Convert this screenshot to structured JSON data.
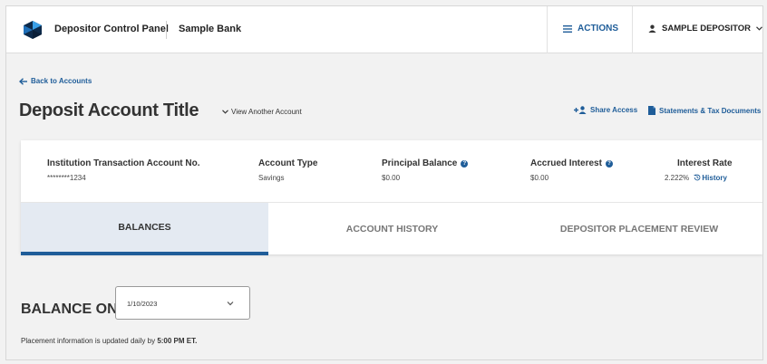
{
  "header": {
    "app_title": "Depositor Control Panel",
    "bank_name": "Sample Bank",
    "actions_label": "ACTIONS",
    "user_label": "SAMPLE DEPOSITOR",
    "brand_color": "#1f5d99"
  },
  "nav": {
    "back_label": "Back to Accounts"
  },
  "page": {
    "title": "Deposit Account Title",
    "view_another_label": "View Another Account",
    "share_access_label": "Share Access",
    "statements_label": "Statements & Tax Documents"
  },
  "summary": {
    "account_no_label": "Institution Transaction Account No.",
    "account_no_value": "********1234",
    "account_type_label": "Account Type",
    "account_type_value": "Savings",
    "principal_label": "Principal Balance",
    "principal_value": "$0.00",
    "accrued_label": "Accrued Interest",
    "accrued_value": "$0.00",
    "rate_label": "Interest Rate",
    "rate_value": "2.222%",
    "history_label": "History"
  },
  "tabs": [
    {
      "label": "BALANCES",
      "active": true
    },
    {
      "label": "ACCOUNT HISTORY",
      "active": false
    },
    {
      "label": "DEPOSITOR PLACEMENT REVIEW",
      "active": false
    }
  ],
  "balance": {
    "label": "BALANCE ON",
    "date_value": "1/10/2023",
    "note_prefix": "Placement information is updated daily by ",
    "note_time": "5:00 PM ET."
  },
  "icons": {
    "logo": "bank-logo-icon",
    "actions": "menu-icon",
    "user": "person-icon",
    "back": "arrow-left-icon",
    "share": "add-person-icon",
    "statements": "document-icon",
    "info": "info-icon",
    "history": "history-icon",
    "chevron": "chevron-down-icon"
  }
}
